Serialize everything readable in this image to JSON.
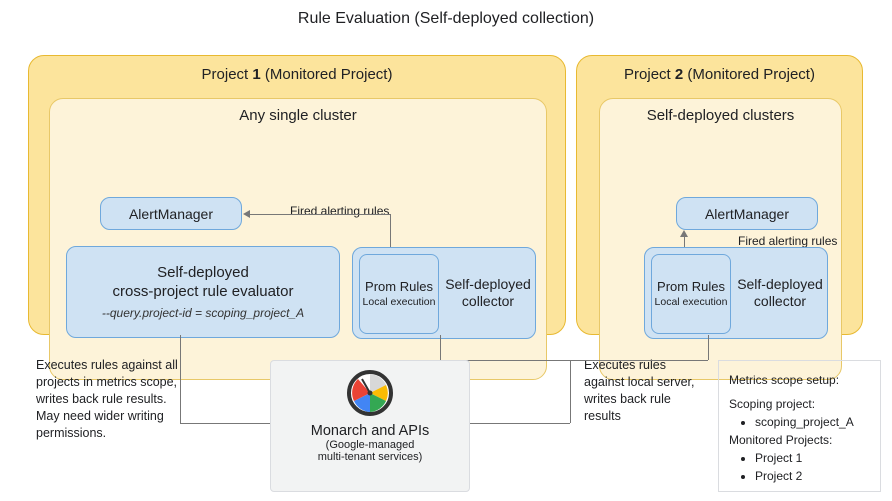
{
  "title": "Rule Evaluation (Self-deployed collection)",
  "project1": {
    "title_prefix": "Project ",
    "title_num": "1",
    "title_suffix": " (Monitored Project)",
    "cluster_title": "Any single cluster",
    "alertmanager": "AlertManager",
    "fired_label": "Fired alerting rules",
    "evaluator_line1": "Self-deployed",
    "evaluator_line2": "cross-project rule evaluator",
    "evaluator_flag": "--query.project-id = scoping_project_A",
    "prom_main": "Prom Rules",
    "prom_sub": "Local execution",
    "collector_label": "Self-deployed collector"
  },
  "project2": {
    "title_prefix": "Project ",
    "title_num": "2",
    "title_suffix": " (Monitored Project)",
    "cluster_title": "Self-deployed clusters",
    "alertmanager": "AlertManager",
    "fired_label": "Fired alerting rules",
    "prom_main": "Prom Rules",
    "prom_sub": "Local execution",
    "collector_label": "Self-deployed collector"
  },
  "annotations": {
    "left": "Executes rules against all projects in metrics scope, writes back rule results. May need wider writing permissions.",
    "mid": "Executes rules against local server, writes back rule results"
  },
  "monarch": {
    "main": "Monarch and APIs",
    "sub1": "(Google-managed",
    "sub2": "multi-tenant services)"
  },
  "scope": {
    "header": "Metrics scope setup:",
    "scoping_label": "Scoping project:",
    "scoping_value": "scoping_project_A",
    "monitored_label": "Monitored Projects:",
    "monitored_1": "Project 1",
    "monitored_2": "Project 2"
  }
}
